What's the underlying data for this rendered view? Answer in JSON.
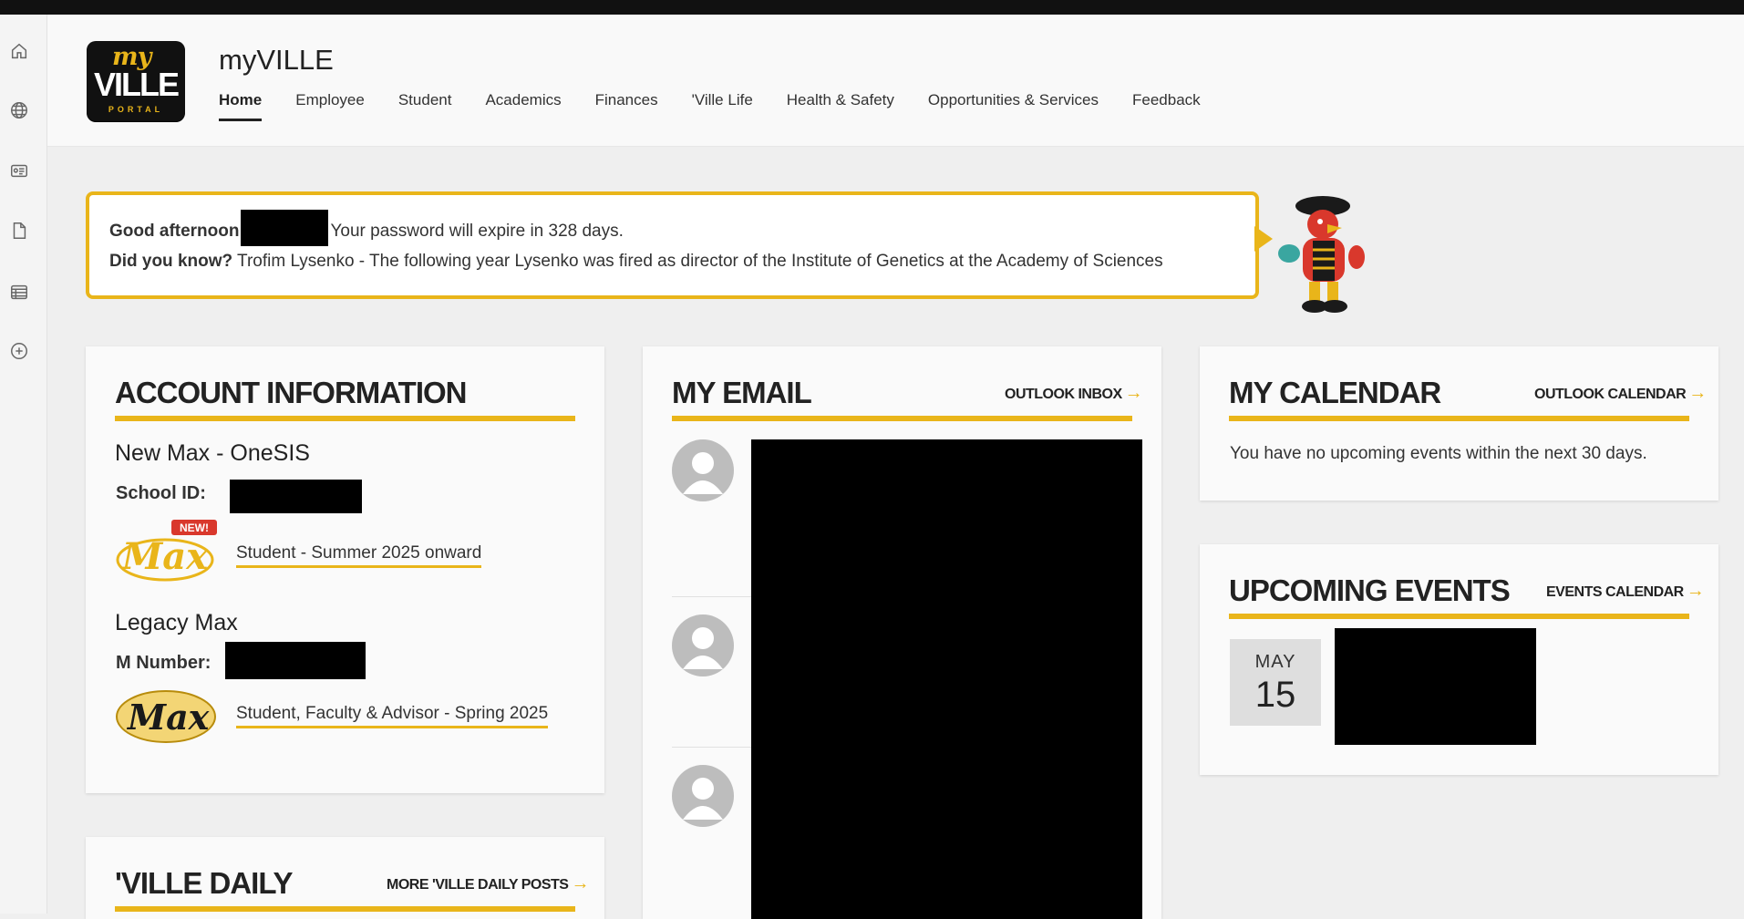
{
  "app": {
    "brand": "myVILLE",
    "logo": {
      "my": "my",
      "ville": "VILLE",
      "portal": "PORTAL"
    }
  },
  "nav": {
    "items": [
      "Home",
      "Employee",
      "Student",
      "Academics",
      "Finances",
      "'Ville Life",
      "Health & Safety",
      "Opportunities & Services",
      "Feedback"
    ],
    "active": "Home"
  },
  "rail": {
    "icons": [
      "home-icon",
      "globe-icon",
      "id-card-icon",
      "document-icon",
      "list-icon",
      "add-circle-icon"
    ]
  },
  "greeting": {
    "salutation": "Good afternoon",
    "password_notice": "Your password will expire in 328 days.",
    "did_you_know_label": "Did you know?",
    "did_you_know_text": "Trofim Lysenko - The following year Lysenko was fired as director of the Institute of Genetics at the Academy of Sciences"
  },
  "account": {
    "title": "ACCOUNT INFORMATION",
    "onesis_title": "New Max - OneSIS",
    "school_id_label": "School ID:",
    "new_badge": "NEW!",
    "max_new_text": "Max",
    "onesis_link": "Student - Summer 2025 onward",
    "legacy_title": "Legacy Max",
    "m_number_label": "M Number:",
    "max_legacy_text": "Max",
    "legacy_link": "Student, Faculty & Advisor - Spring 2025"
  },
  "email": {
    "title": "MY EMAIL",
    "link": "OUTLOOK INBOX"
  },
  "calendar": {
    "title": "MY CALENDAR",
    "link": "OUTLOOK CALENDAR",
    "empty_text": "You have no upcoming events within the next 30 days."
  },
  "events": {
    "title": "UPCOMING EVENTS",
    "link": "EVENTS CALENDAR",
    "month": "MAY",
    "day": "15"
  },
  "daily": {
    "title": "'VILLE DAILY",
    "link": "MORE 'VILLE DAILY POSTS"
  },
  "colors": {
    "accent": "#e9b51a",
    "dark": "#111111",
    "background": "#efefef"
  }
}
